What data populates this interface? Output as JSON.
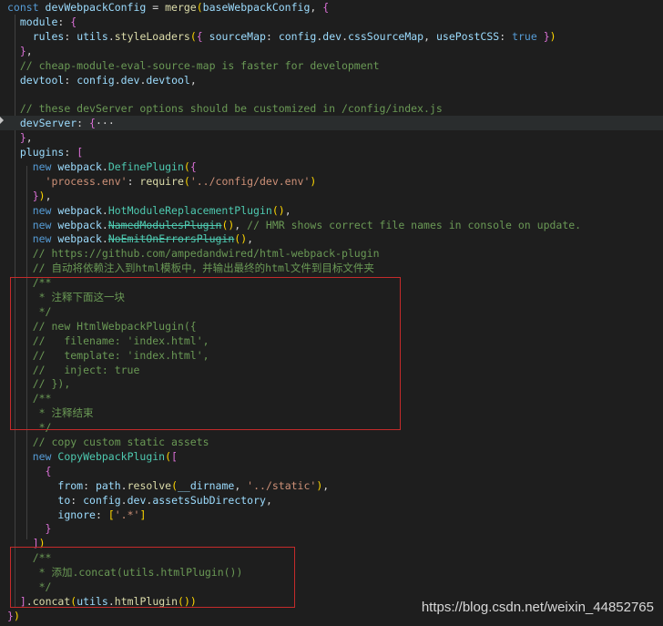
{
  "code_lines": [
    {
      "indent": "",
      "tokens": [
        {
          "t": "const ",
          "c": "k"
        },
        {
          "t": "devWebpackConfig",
          "c": "v"
        },
        {
          "t": " = ",
          "c": "p"
        },
        {
          "t": "merge",
          "c": "f"
        },
        {
          "t": "(",
          "c": "y"
        },
        {
          "t": "baseWebpackConfig",
          "c": "v"
        },
        {
          "t": ", ",
          "c": "p"
        },
        {
          "t": "{",
          "c": "m"
        }
      ]
    },
    {
      "indent": "  ",
      "tokens": [
        {
          "t": "module",
          "c": "v"
        },
        {
          "t": ": ",
          "c": "p"
        },
        {
          "t": "{",
          "c": "m"
        }
      ]
    },
    {
      "indent": "    ",
      "tokens": [
        {
          "t": "rules",
          "c": "v"
        },
        {
          "t": ": ",
          "c": "p"
        },
        {
          "t": "utils",
          "c": "v"
        },
        {
          "t": ".",
          "c": "p"
        },
        {
          "t": "styleLoaders",
          "c": "f"
        },
        {
          "t": "(",
          "c": "y"
        },
        {
          "t": "{ ",
          "c": "m"
        },
        {
          "t": "sourceMap",
          "c": "v"
        },
        {
          "t": ": ",
          "c": "p"
        },
        {
          "t": "config",
          "c": "v"
        },
        {
          "t": ".",
          "c": "p"
        },
        {
          "t": "dev",
          "c": "v"
        },
        {
          "t": ".",
          "c": "p"
        },
        {
          "t": "cssSourceMap",
          "c": "v"
        },
        {
          "t": ", ",
          "c": "p"
        },
        {
          "t": "usePostCSS",
          "c": "v"
        },
        {
          "t": ": ",
          "c": "p"
        },
        {
          "t": "true",
          "c": "k"
        },
        {
          "t": " }",
          "c": "m"
        },
        {
          "t": ")",
          "c": "y"
        }
      ]
    },
    {
      "indent": "  ",
      "tokens": [
        {
          "t": "}",
          "c": "m"
        },
        {
          "t": ",",
          "c": "p"
        }
      ]
    },
    {
      "indent": "  ",
      "tokens": [
        {
          "t": "// cheap-module-eval-source-map is faster for development",
          "c": "c"
        }
      ]
    },
    {
      "indent": "  ",
      "tokens": [
        {
          "t": "devtool",
          "c": "v"
        },
        {
          "t": ": ",
          "c": "p"
        },
        {
          "t": "config",
          "c": "v"
        },
        {
          "t": ".",
          "c": "p"
        },
        {
          "t": "dev",
          "c": "v"
        },
        {
          "t": ".",
          "c": "p"
        },
        {
          "t": "devtool",
          "c": "v"
        },
        {
          "t": ",",
          "c": "p"
        }
      ]
    },
    {
      "indent": "",
      "tokens": []
    },
    {
      "indent": "  ",
      "tokens": [
        {
          "t": "// these devServer options should be customized in /config/index.js",
          "c": "c"
        }
      ]
    },
    {
      "indent": "  ",
      "tokens": [
        {
          "t": "devServer",
          "c": "v"
        },
        {
          "t": ": ",
          "c": "p"
        },
        {
          "t": "{",
          "c": "m"
        },
        {
          "t": "···",
          "c": "p"
        }
      ]
    },
    {
      "indent": "  ",
      "tokens": [
        {
          "t": "}",
          "c": "m"
        },
        {
          "t": ",",
          "c": "p"
        }
      ]
    },
    {
      "indent": "  ",
      "tokens": [
        {
          "t": "plugins",
          "c": "v"
        },
        {
          "t": ": ",
          "c": "p"
        },
        {
          "t": "[",
          "c": "m"
        }
      ]
    },
    {
      "indent": "    ",
      "tokens": [
        {
          "t": "new ",
          "c": "k"
        },
        {
          "t": "webpack",
          "c": "v"
        },
        {
          "t": ".",
          "c": "p"
        },
        {
          "t": "DefinePlugin",
          "c": "t"
        },
        {
          "t": "(",
          "c": "y"
        },
        {
          "t": "{",
          "c": "m"
        }
      ]
    },
    {
      "indent": "      ",
      "tokens": [
        {
          "t": "'process.env'",
          "c": "s"
        },
        {
          "t": ": ",
          "c": "p"
        },
        {
          "t": "require",
          "c": "f"
        },
        {
          "t": "(",
          "c": "y"
        },
        {
          "t": "'../config/dev.env'",
          "c": "s"
        },
        {
          "t": ")",
          "c": "y"
        }
      ]
    },
    {
      "indent": "    ",
      "tokens": [
        {
          "t": "}",
          "c": "m"
        },
        {
          "t": ")",
          "c": "y"
        },
        {
          "t": ",",
          "c": "p"
        }
      ]
    },
    {
      "indent": "    ",
      "tokens": [
        {
          "t": "new ",
          "c": "k"
        },
        {
          "t": "webpack",
          "c": "v"
        },
        {
          "t": ".",
          "c": "p"
        },
        {
          "t": "HotModuleReplacementPlugin",
          "c": "t"
        },
        {
          "t": "()",
          "c": "y"
        },
        {
          "t": ",",
          "c": "p"
        }
      ]
    },
    {
      "indent": "    ",
      "tokens": [
        {
          "t": "new ",
          "c": "k"
        },
        {
          "t": "webpack",
          "c": "v"
        },
        {
          "t": ".",
          "c": "p"
        },
        {
          "t": "NamedModulesPlugin",
          "c": "t strike"
        },
        {
          "t": "()",
          "c": "y"
        },
        {
          "t": ", ",
          "c": "p"
        },
        {
          "t": "// HMR shows correct file names in console on update.",
          "c": "c"
        }
      ]
    },
    {
      "indent": "    ",
      "tokens": [
        {
          "t": "new ",
          "c": "k"
        },
        {
          "t": "webpack",
          "c": "v"
        },
        {
          "t": ".",
          "c": "p"
        },
        {
          "t": "NoEmitOnErrorsPlugin",
          "c": "t strike"
        },
        {
          "t": "()",
          "c": "y"
        },
        {
          "t": ",",
          "c": "p"
        }
      ]
    },
    {
      "indent": "    ",
      "tokens": [
        {
          "t": "// https://github.com/ampedandwired/html-webpack-plugin",
          "c": "c"
        }
      ]
    },
    {
      "indent": "    ",
      "tokens": [
        {
          "t": "// 自动将依赖注入到html模板中，并输出最终的html文件到目标文件夹",
          "c": "c"
        }
      ]
    },
    {
      "indent": "    ",
      "tokens": [
        {
          "t": "/**",
          "c": "c"
        }
      ]
    },
    {
      "indent": "     ",
      "tokens": [
        {
          "t": "* 注释下面这一块",
          "c": "c"
        }
      ]
    },
    {
      "indent": "     ",
      "tokens": [
        {
          "t": "*/",
          "c": "c"
        }
      ]
    },
    {
      "indent": "    ",
      "tokens": [
        {
          "t": "// new HtmlWebpackPlugin({",
          "c": "c"
        }
      ]
    },
    {
      "indent": "    ",
      "tokens": [
        {
          "t": "//   filename: 'index.html',",
          "c": "c"
        }
      ]
    },
    {
      "indent": "    ",
      "tokens": [
        {
          "t": "//   template: 'index.html',",
          "c": "c"
        }
      ]
    },
    {
      "indent": "    ",
      "tokens": [
        {
          "t": "//   inject: true",
          "c": "c"
        }
      ]
    },
    {
      "indent": "    ",
      "tokens": [
        {
          "t": "// }),",
          "c": "c"
        }
      ]
    },
    {
      "indent": "    ",
      "tokens": [
        {
          "t": "/**",
          "c": "c"
        }
      ]
    },
    {
      "indent": "     ",
      "tokens": [
        {
          "t": "* 注释结束",
          "c": "c"
        }
      ]
    },
    {
      "indent": "     ",
      "tokens": [
        {
          "t": "*/",
          "c": "c"
        }
      ]
    },
    {
      "indent": "    ",
      "tokens": [
        {
          "t": "// copy custom static assets",
          "c": "c"
        }
      ]
    },
    {
      "indent": "    ",
      "tokens": [
        {
          "t": "new ",
          "c": "k"
        },
        {
          "t": "CopyWebpackPlugin",
          "c": "t"
        },
        {
          "t": "(",
          "c": "y"
        },
        {
          "t": "[",
          "c": "m"
        }
      ]
    },
    {
      "indent": "      ",
      "tokens": [
        {
          "t": "{",
          "c": "m"
        }
      ]
    },
    {
      "indent": "        ",
      "tokens": [
        {
          "t": "from",
          "c": "v"
        },
        {
          "t": ": ",
          "c": "p"
        },
        {
          "t": "path",
          "c": "v"
        },
        {
          "t": ".",
          "c": "p"
        },
        {
          "t": "resolve",
          "c": "f"
        },
        {
          "t": "(",
          "c": "y"
        },
        {
          "t": "__dirname",
          "c": "v"
        },
        {
          "t": ", ",
          "c": "p"
        },
        {
          "t": "'../static'",
          "c": "s"
        },
        {
          "t": ")",
          "c": "y"
        },
        {
          "t": ",",
          "c": "p"
        }
      ]
    },
    {
      "indent": "        ",
      "tokens": [
        {
          "t": "to",
          "c": "v"
        },
        {
          "t": ": ",
          "c": "p"
        },
        {
          "t": "config",
          "c": "v"
        },
        {
          "t": ".",
          "c": "p"
        },
        {
          "t": "dev",
          "c": "v"
        },
        {
          "t": ".",
          "c": "p"
        },
        {
          "t": "assetsSubDirectory",
          "c": "v"
        },
        {
          "t": ",",
          "c": "p"
        }
      ]
    },
    {
      "indent": "        ",
      "tokens": [
        {
          "t": "ignore",
          "c": "v"
        },
        {
          "t": ": ",
          "c": "p"
        },
        {
          "t": "[",
          "c": "y"
        },
        {
          "t": "'.*'",
          "c": "s"
        },
        {
          "t": "]",
          "c": "y"
        }
      ]
    },
    {
      "indent": "      ",
      "tokens": [
        {
          "t": "}",
          "c": "m"
        }
      ]
    },
    {
      "indent": "    ",
      "tokens": [
        {
          "t": "]",
          "c": "m"
        },
        {
          "t": ")",
          "c": "y"
        }
      ]
    },
    {
      "indent": "    ",
      "tokens": [
        {
          "t": "/**",
          "c": "c"
        }
      ]
    },
    {
      "indent": "     ",
      "tokens": [
        {
          "t": "* 添加.concat(utils.htmlPlugin())",
          "c": "c"
        }
      ]
    },
    {
      "indent": "     ",
      "tokens": [
        {
          "t": "*/",
          "c": "c"
        }
      ]
    },
    {
      "indent": "  ",
      "tokens": [
        {
          "t": "]",
          "c": "m"
        },
        {
          "t": ".",
          "c": "p"
        },
        {
          "t": "concat",
          "c": "f"
        },
        {
          "t": "(",
          "c": "y"
        },
        {
          "t": "utils",
          "c": "v"
        },
        {
          "t": ".",
          "c": "p"
        },
        {
          "t": "htmlPlugin",
          "c": "f"
        },
        {
          "t": "()",
          "c": "y"
        },
        {
          "t": ")",
          "c": "y"
        }
      ]
    },
    {
      "indent": "",
      "tokens": [
        {
          "t": "}",
          "c": "m"
        },
        {
          "t": ")",
          "c": "y"
        }
      ]
    }
  ],
  "watermark": "https://blog.csdn.net/weixin_44852765",
  "colors": {
    "background": "#1e1e1e",
    "highlight_box": "#c42b2b",
    "keyword": "#569cd6",
    "comment": "#6a9955",
    "string": "#ce9178",
    "function": "#dcdcaa",
    "variable": "#9cdcfe",
    "class": "#4ec9b0"
  }
}
